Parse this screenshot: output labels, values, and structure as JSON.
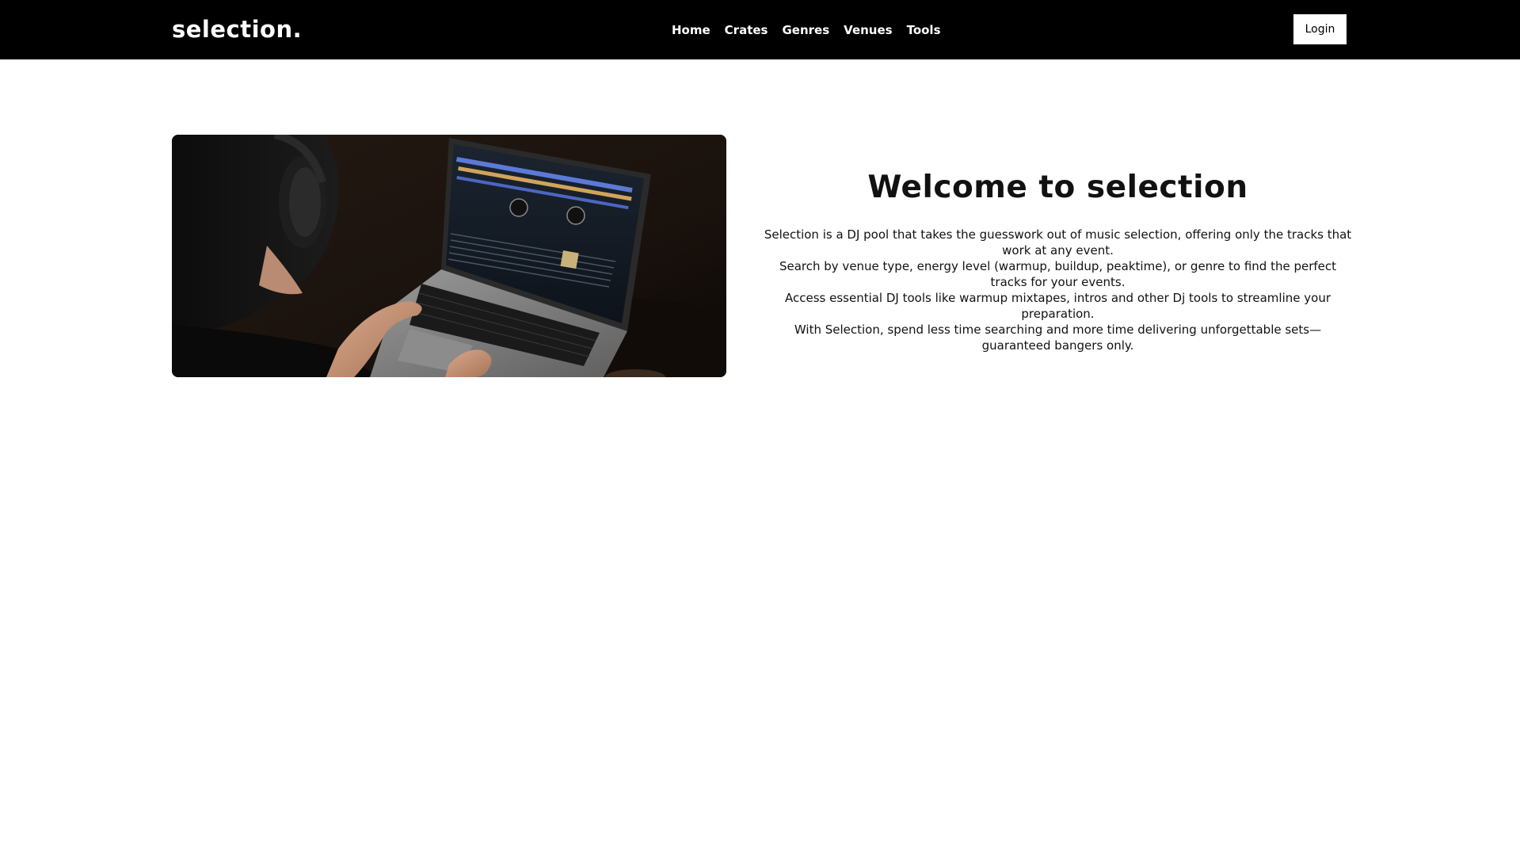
{
  "header": {
    "logo": "selection.",
    "nav": [
      {
        "label": "Home"
      },
      {
        "label": "Crates"
      },
      {
        "label": "Genres"
      },
      {
        "label": "Venues"
      },
      {
        "label": "Tools"
      }
    ],
    "login_label": "Login"
  },
  "hero": {
    "image_icon": "dj-laptop-photo",
    "title": "Welcome to selection",
    "paragraphs": [
      "Selection is a DJ pool that takes the guesswork out of music selection, offering only the tracks that work at any event.",
      "Search by venue type, energy level (warmup, buildup, peaktime), or genre to find the perfect tracks for your events.",
      "Access essential DJ tools like warmup mixtapes, intros and other Dj tools to streamline your preparation.",
      "With Selection, spend less time searching and more time delivering unforgettable sets—guaranteed bangers only."
    ]
  },
  "colors": {
    "header_bg": "#000000",
    "page_bg": "#ffffff",
    "text": "#111111",
    "button_bg": "#ffffff"
  }
}
